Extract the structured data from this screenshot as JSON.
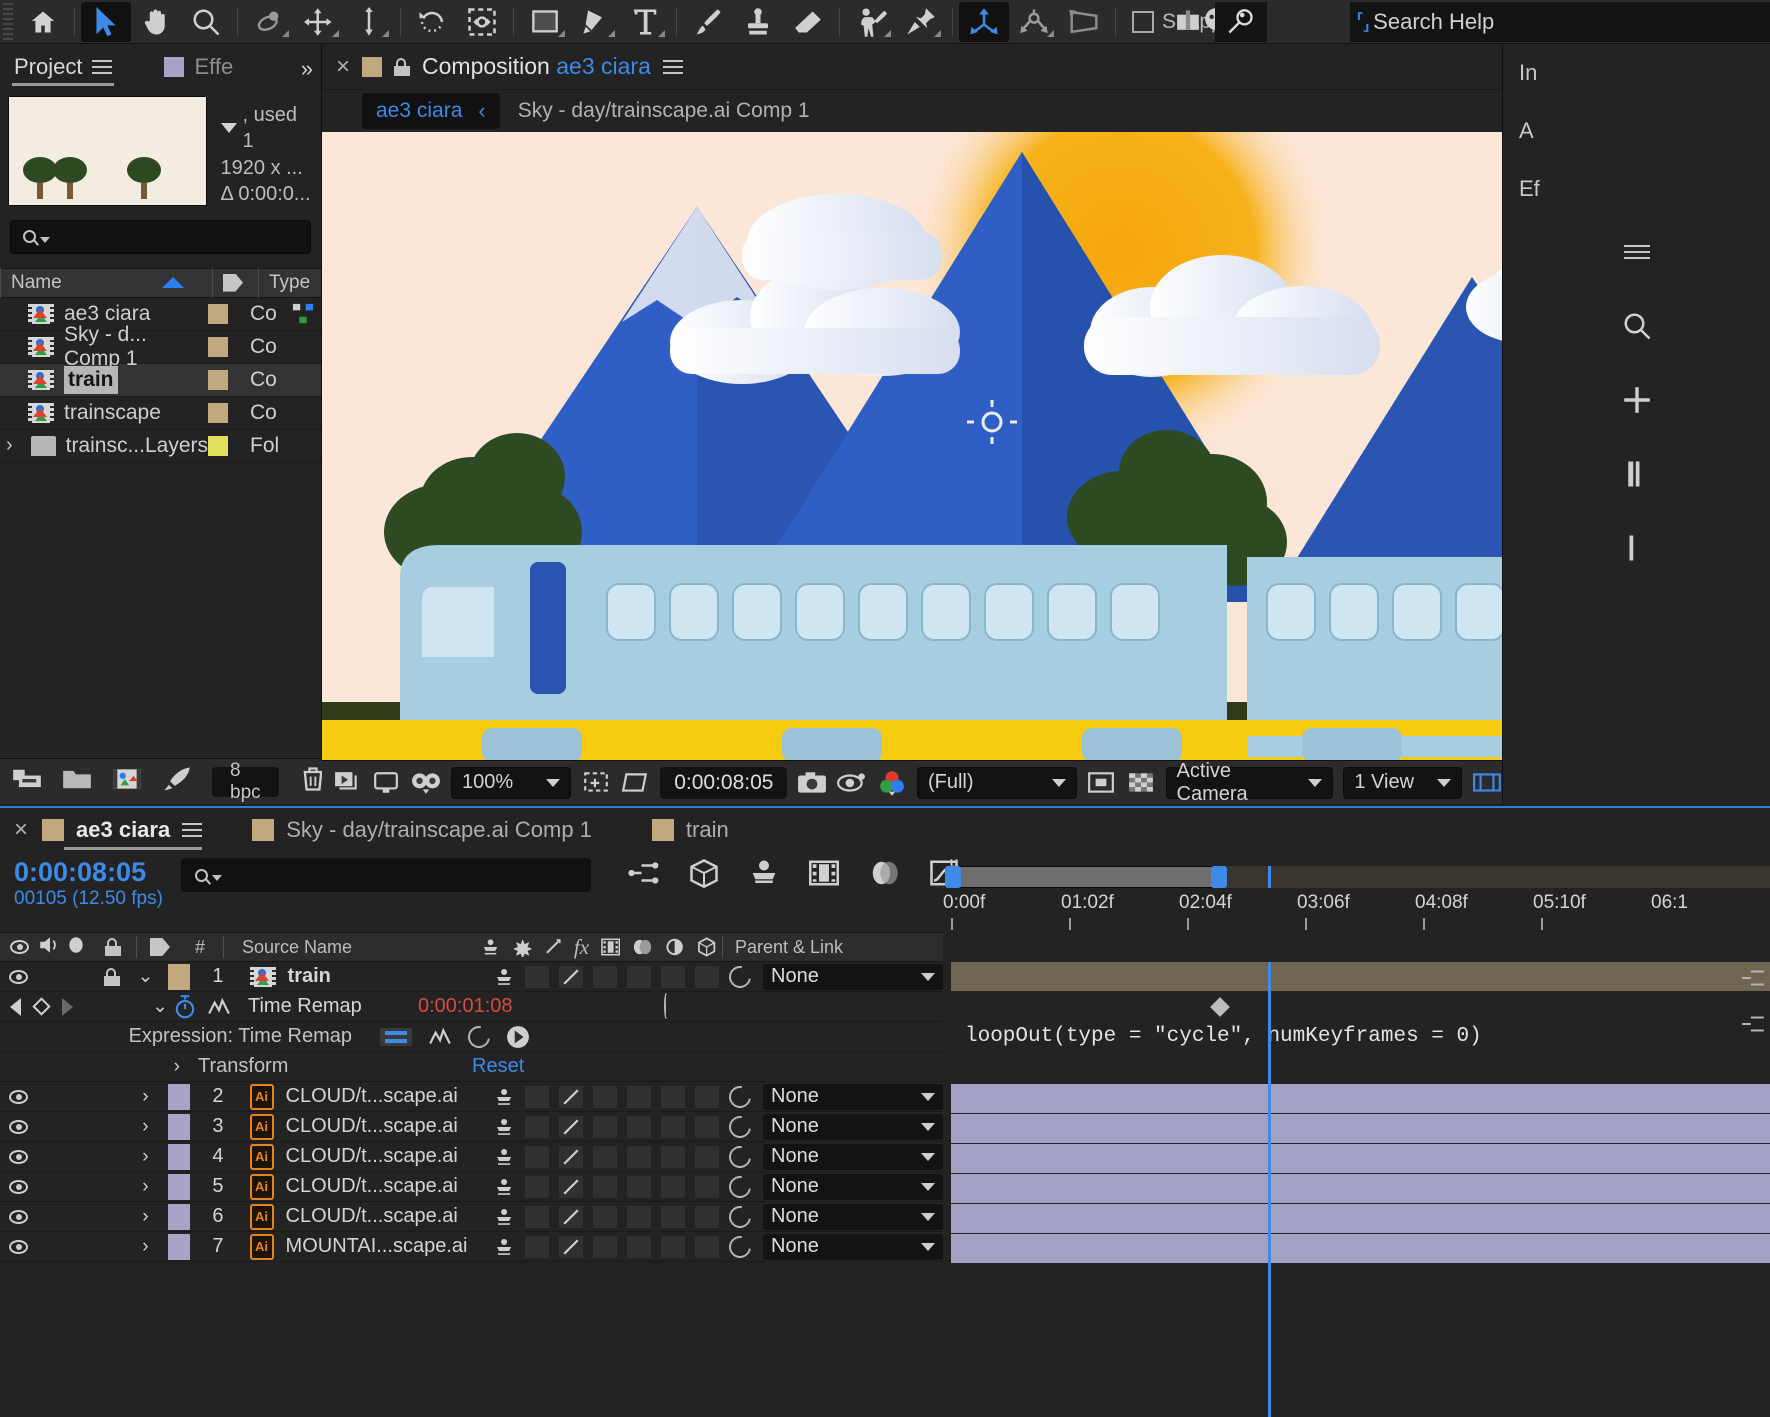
{
  "toolbar": {
    "tools": [
      {
        "name": "home-icon",
        "label": "Home"
      },
      {
        "name": "selection-tool",
        "label": "Selection"
      },
      {
        "name": "hand-tool",
        "label": "Hand"
      },
      {
        "name": "zoom-tool",
        "label": "Zoom"
      },
      {
        "name": "orbit-tool",
        "label": "Orbit"
      },
      {
        "name": "pan-tool",
        "label": "Pan Under"
      },
      {
        "name": "dolly-tool",
        "label": "Dolly"
      },
      {
        "name": "rotation-tool",
        "label": "Rotation"
      },
      {
        "name": "anchor-point-tool",
        "label": "Anchor Point"
      },
      {
        "name": "shape-tool",
        "label": "Rectangle"
      },
      {
        "name": "pen-tool",
        "label": "Pen"
      },
      {
        "name": "type-tool",
        "label": "Type"
      },
      {
        "name": "brush-tool",
        "label": "Brush"
      },
      {
        "name": "clone-stamp-tool",
        "label": "Clone Stamp"
      },
      {
        "name": "eraser-tool",
        "label": "Eraser"
      },
      {
        "name": "roto-brush-tool",
        "label": "Roto Brush"
      },
      {
        "name": "puppet-pin-tool",
        "label": "Puppet Pin"
      },
      {
        "name": "unified-camera-tool",
        "label": "Unified Camera"
      },
      {
        "name": "orbit-camera-tool",
        "label": "Orbit Camera"
      },
      {
        "name": "pan-camera-tool",
        "label": "Pan Camera"
      }
    ],
    "snapping_label": "Snapping",
    "search_help_placeholder": "Search Help"
  },
  "project": {
    "tabs": [
      {
        "label": "Project",
        "active": true
      },
      {
        "label": "Effe",
        "active": false
      }
    ],
    "preview_meta": {
      "used": ", used 1",
      "dimensions": "1920 x ...",
      "duration": "Δ 0:00:0..."
    },
    "search_placeholder": "",
    "columns": [
      "Name",
      "Type"
    ],
    "items": [
      {
        "name": "ae3 ciara",
        "type": "Co",
        "icon": "comp-icon",
        "label_color": "#c1a87e",
        "selected": false
      },
      {
        "name": "Sky - d... Comp 1",
        "type": "Co",
        "icon": "comp-icon",
        "label_color": "#c1a87e",
        "selected": false
      },
      {
        "name": "train",
        "type": "Co",
        "icon": "comp-icon",
        "label_color": "#c1a87e",
        "selected": true
      },
      {
        "name": "trainscape",
        "type": "Co",
        "icon": "comp-icon",
        "label_color": "#c1a87e",
        "selected": false
      },
      {
        "name": "trainsc...Layers",
        "type": "Fol",
        "icon": "folder-icon",
        "label_color": "#e3e05c",
        "selected": false
      }
    ],
    "bottom": {
      "bit_depth": "8 bpc"
    }
  },
  "composition": {
    "panel_label": "Composition",
    "comp_name": "ae3 ciara",
    "breadcrumb_active": "ae3 ciara",
    "breadcrumb_next": "Sky - day/trainscape.ai Comp 1",
    "viewer_toolbar": {
      "magnification": "100%",
      "current_time": "0:00:08:05",
      "resolution": "(Full)",
      "camera": "Active Camera",
      "views": "1 View"
    }
  },
  "right_dock": {
    "tabs": [
      "In",
      "A",
      "Ef"
    ]
  },
  "timeline": {
    "tabs": [
      {
        "label": "ae3 ciara",
        "active": true
      },
      {
        "label": "Sky - day/trainscape.ai Comp 1",
        "active": false
      },
      {
        "label": "train",
        "active": false
      }
    ],
    "current_time": "0:00:08:05",
    "frame_info": "00105 (12.50 fps)",
    "search_placeholder": "",
    "columns": [
      "#",
      "Source Name",
      "Parent & Link"
    ],
    "ruler_labels": [
      "0:00f",
      "01:02f",
      "02:04f",
      "03:06f",
      "04:08f",
      "05:10f",
      "06:1"
    ],
    "layers": [
      {
        "index": "1",
        "name": "train",
        "icon": "comp-icon",
        "label_color": "#c1a87e",
        "parent": "None",
        "type": "comp",
        "locked": true,
        "expanded": true
      },
      {
        "index": "2",
        "name": "CLOUD/t...scape.ai",
        "icon": "ai-icon",
        "label_color": "#a8a4c8",
        "parent": "None",
        "type": "ai"
      },
      {
        "index": "3",
        "name": "CLOUD/t...scape.ai",
        "icon": "ai-icon",
        "label_color": "#a8a4c8",
        "parent": "None",
        "type": "ai"
      },
      {
        "index": "4",
        "name": "CLOUD/t...scape.ai",
        "icon": "ai-icon",
        "label_color": "#a8a4c8",
        "parent": "None",
        "type": "ai"
      },
      {
        "index": "5",
        "name": "CLOUD/t...scape.ai",
        "icon": "ai-icon",
        "label_color": "#a8a4c8",
        "parent": "None",
        "type": "ai"
      },
      {
        "index": "6",
        "name": "CLOUD/t...scape.ai",
        "icon": "ai-icon",
        "label_color": "#a8a4c8",
        "parent": "None",
        "type": "ai"
      },
      {
        "index": "7",
        "name": "MOUNTAI...scape.ai",
        "icon": "ai-icon",
        "label_color": "#a8a4c8",
        "parent": "None",
        "type": "ai"
      }
    ],
    "time_remap": {
      "property_label": "Time Remap",
      "value": "0:00:01:08"
    },
    "expression": {
      "label": "Expression: Time Remap",
      "code": "loopOut(type = \"cycle\", numKeyframes = 0)"
    },
    "transform": {
      "label": "Transform",
      "reset_label": "Reset"
    }
  },
  "colors": {
    "accent_blue": "#3d8ae8",
    "panel_bg": "#232323",
    "toolbar_bg": "#2b2b2b",
    "label_tan": "#c1a87e",
    "label_violet": "#a8a4c8",
    "expression_red": "#d9493c"
  }
}
